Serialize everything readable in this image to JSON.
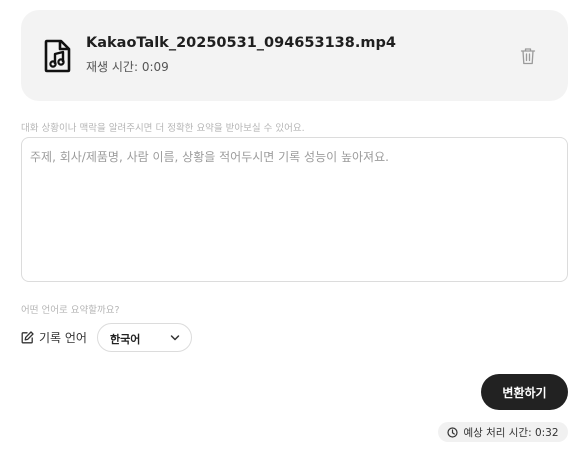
{
  "file": {
    "name": "KakaoTalk_20250531_094653138.mp4",
    "duration": "재생 시간: 0:09",
    "icon": "music-file-icon",
    "delete_icon": "trash-icon"
  },
  "context": {
    "hint": "대화 상황이나 맥락을 알려주시면 더 정확한 요약을 받아보실 수 있어요.",
    "placeholder": "주제, 회사/제품명, 사람 이름, 상황을 적어두시면 기록 성능이 높아져요.",
    "value": ""
  },
  "language": {
    "hint": "어떤 언어로 요약할까요?",
    "label": "기록 언어",
    "label_icon": "edit-icon",
    "selected": "한국어",
    "dropdown_icon": "chevron-down-icon"
  },
  "actions": {
    "convert_label": "변환하기"
  },
  "estimate": {
    "text": "예상 처리 시간: 0:32",
    "icon": "clock-icon"
  },
  "colors": {
    "card_bg": "#f3f3f3",
    "button_bg": "#222222",
    "hint_text": "#b5b5b5"
  }
}
